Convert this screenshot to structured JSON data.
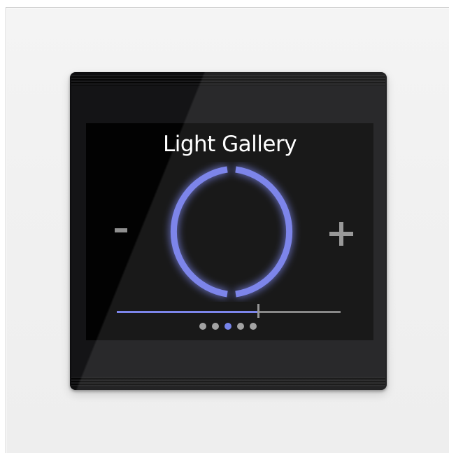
{
  "screen": {
    "title": "Light Gallery",
    "minus_icon": "minus-icon",
    "plus_icon": "plus-icon",
    "accent_color": "#6f79e8",
    "dial_icon": "power-ring-icon"
  },
  "slider": {
    "level": 0.63
  },
  "pager": {
    "count": 5,
    "active_index": 2
  }
}
